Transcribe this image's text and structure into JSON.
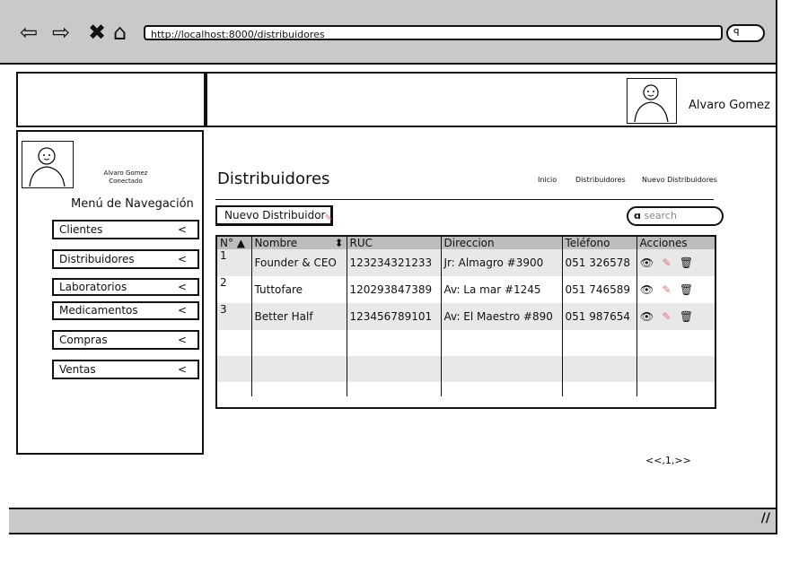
{
  "browser": {
    "url": "http://localhost:8000/distribuidores",
    "icons": [
      "back-icon",
      "forward-icon",
      "close-icon",
      "home-icon",
      "search-icon"
    ]
  },
  "header": {
    "user_name": "Alvaro Gomez"
  },
  "sidebar": {
    "user_name": "Alvaro Gomez",
    "user_status": "Conectado",
    "menu_title": "Menú de Navegación",
    "items": [
      {
        "label": "Clientes",
        "chevron": "<"
      },
      {
        "label": "Distribuidores",
        "chevron": "<"
      },
      {
        "label": "Laboratorios",
        "chevron": "<"
      },
      {
        "label": "Medicamentos",
        "chevron": "<"
      },
      {
        "label": "Compras",
        "chevron": "<"
      },
      {
        "label": "Ventas",
        "chevron": "<"
      }
    ]
  },
  "main": {
    "title": "Distribuidores",
    "breadcrumb": [
      "Inicio",
      "Distribuidores",
      "Nuevo Distribuidores"
    ],
    "new_button": "Nuevo Distribuidor",
    "search_placeholder": "search",
    "table": {
      "columns": [
        "N° ▲",
        "Nombre",
        "RUC",
        "Direccion",
        "Teléfono",
        "Acciones"
      ],
      "rows": [
        {
          "n": "1",
          "nombre": "Founder & CEO",
          "ruc": "123234321233",
          "direccion": "Jr: Almagro #3900",
          "telefono": "051 326578"
        },
        {
          "n": "2",
          "nombre": "Tuttofare",
          "ruc": "120293847389",
          "direccion": "Av: La mar #1245",
          "telefono": "051 746589"
        },
        {
          "n": "3",
          "nombre": "Better Half",
          "ruc": "123456789101",
          "direccion": "Av: El Maestro #890",
          "telefono": "051 987654"
        }
      ]
    },
    "pagination": "<<,1,>>"
  }
}
